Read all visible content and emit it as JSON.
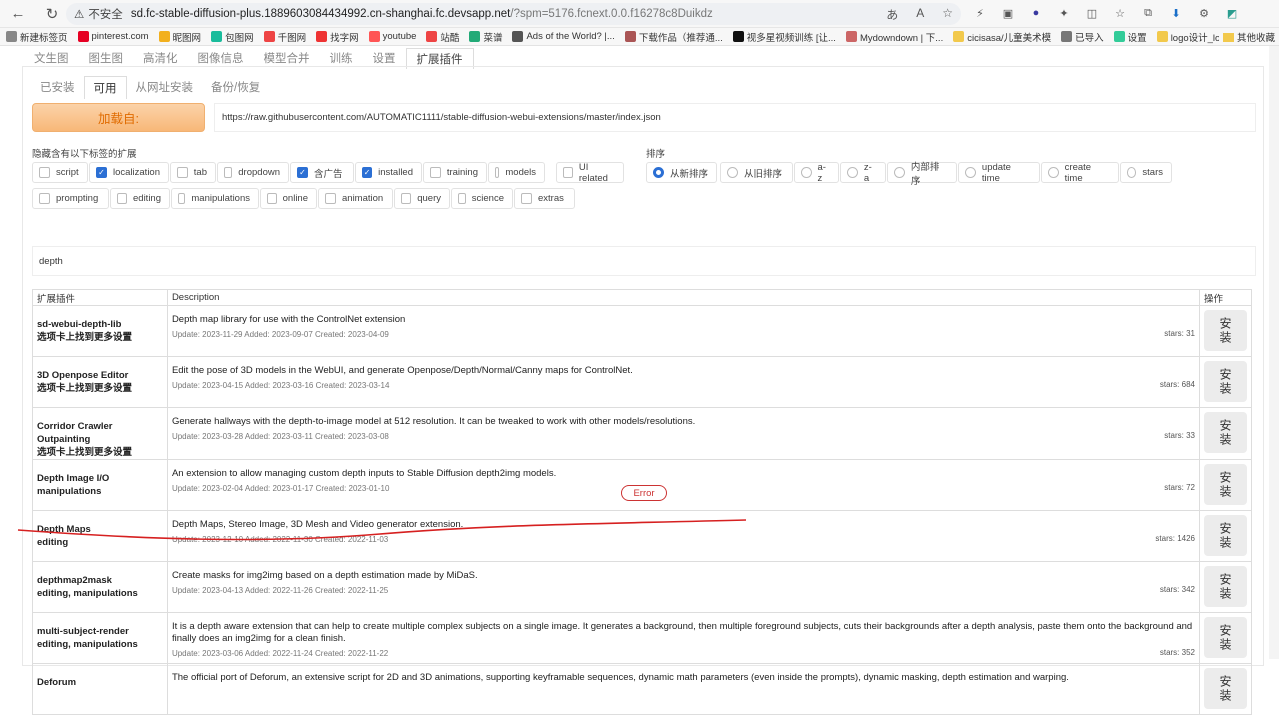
{
  "browser": {
    "security": "不安全",
    "url_host": "sd.fc-stable-diffusion-plus.1889603084434992.cn-shanghai.fc.devsapp.net",
    "url_rest": "/?spm=5176.fcnext.0.0.f16278c8Duikdz",
    "bookmarks": [
      "新建标签页",
      "pinterest.com",
      "昵图网",
      "包图网",
      "千图网",
      "找字网",
      "youtube",
      "站酷",
      "菜谱",
      "Ads of the World? |...",
      "下载作品（推荐通...",
      "视多星视频训练 [让...",
      "Mydowndown | 下...",
      "cicisasa/儿童美术模",
      "已导入",
      "设置",
      "logo设计_logo在线..."
    ],
    "other_bookmarks": "其他收藏"
  },
  "top_tabs": [
    "文生图",
    "图生图",
    "高清化",
    "图像信息",
    "模型合并",
    "训练",
    "设置",
    "扩展插件"
  ],
  "sub_tabs": [
    "已安装",
    "可用",
    "从网址安装",
    "备份/恢复"
  ],
  "load_button": "加载自:",
  "index_url": "https://raw.githubusercontent.com/AUTOMATIC1111/stable-diffusion-webui-extensions/master/index.json",
  "hide_label": "隐藏含有以下标签的扩展",
  "sort_label": "排序",
  "tags_row1": [
    {
      "label": "script",
      "checked": false
    },
    {
      "label": "localization",
      "checked": true
    },
    {
      "label": "tab",
      "checked": false
    },
    {
      "label": "dropdown",
      "checked": false
    },
    {
      "label": "含广告",
      "checked": true
    },
    {
      "label": "installed",
      "checked": true
    },
    {
      "label": "training",
      "checked": false
    },
    {
      "label": "models",
      "checked": false
    },
    {
      "label": "UI related",
      "checked": false
    }
  ],
  "tags_row2": [
    {
      "label": "prompting",
      "checked": false
    },
    {
      "label": "editing",
      "checked": false
    },
    {
      "label": "manipulations",
      "checked": false
    },
    {
      "label": "online",
      "checked": false
    },
    {
      "label": "animation",
      "checked": false
    },
    {
      "label": "query",
      "checked": false
    },
    {
      "label": "science",
      "checked": false
    },
    {
      "label": "extras",
      "checked": false
    }
  ],
  "sort_options": [
    {
      "label": "从新排序",
      "checked": true
    },
    {
      "label": "从旧排序",
      "checked": false
    },
    {
      "label": "a-z",
      "checked": false
    },
    {
      "label": "z-a",
      "checked": false
    },
    {
      "label": "内部排序",
      "checked": false
    },
    {
      "label": "update time",
      "checked": false
    },
    {
      "label": "create time",
      "checked": false
    },
    {
      "label": "stars",
      "checked": false
    }
  ],
  "search_value": "depth",
  "table": {
    "headers": [
      "扩展插件",
      "Description",
      "操作"
    ],
    "install_label": "安装",
    "rows": [
      {
        "name": "sd-webui-depth-lib",
        "tags": "选项卡上找到更多设置",
        "desc": "Depth map library for use with the ControlNet extension",
        "meta": "Update: 2023-11-29 Added: 2023-09-07 Created: 2023-04-09",
        "stars": "stars: 31"
      },
      {
        "name": "3D Openpose Editor",
        "tags": "选项卡上找到更多设置",
        "desc": "Edit the pose of 3D models in the WebUI, and generate Openpose/Depth/Normal/Canny maps for ControlNet.",
        "meta": "Update: 2023-04-15 Added: 2023-03-16 Created: 2023-03-14",
        "stars": "stars: 684"
      },
      {
        "name": "Corridor Crawler Outpainting",
        "tags": "选项卡上找到更多设置",
        "desc": "Generate hallways with the depth-to-image model at 512 resolution. It can be tweaked to work with other models/resolutions.",
        "meta": "Update: 2023-03-28 Added: 2023-03-11 Created: 2023-03-08",
        "stars": "stars: 33"
      },
      {
        "name": "Depth Image I/O",
        "tags": "manipulations",
        "desc": "An extension to allow managing custom depth inputs to Stable Diffusion depth2img models.",
        "meta": "Update: 2023-02-04 Added: 2023-01-17 Created: 2023-01-10",
        "stars": "stars: 72"
      },
      {
        "name": "Depth Maps",
        "tags": "editing",
        "desc": "Depth Maps, Stereo Image, 3D Mesh and Video generator extension.",
        "meta": "Update: 2023-12-10 Added: 2022-11-30 Created: 2022-11-03",
        "stars": "stars: 1426"
      },
      {
        "name": "depthmap2mask",
        "tags": "editing, manipulations",
        "desc": "Create masks for img2img based on a depth estimation made by MiDaS.",
        "meta": "Update: 2023-04-13 Added: 2022-11-26 Created: 2022-11-25",
        "stars": "stars: 342"
      },
      {
        "name": "multi-subject-render",
        "tags": "editing, manipulations",
        "desc": "It is a depth aware extension that can help to create multiple complex subjects on a single image. It generates a background, then multiple foreground subjects, cuts their backgrounds after a depth analysis, paste them onto the background and finally does an img2img for a clean finish.",
        "meta": "Update: 2023-03-06 Added: 2022-11-24 Created: 2022-11-22",
        "stars": "stars: 352"
      },
      {
        "name": "Deforum",
        "tags": "",
        "desc": "The official port of Deforum, an extensive script for 2D and 3D animations, supporting keyframable sequences, dynamic math parameters (even inside the prompts), dynamic masking, depth estimation and warping.",
        "meta": "",
        "stars": ""
      }
    ]
  },
  "error_badge": "Error",
  "colors": {
    "accent": "#2b6fd4",
    "load_button": "#f8b878",
    "error": "#cc3333"
  }
}
